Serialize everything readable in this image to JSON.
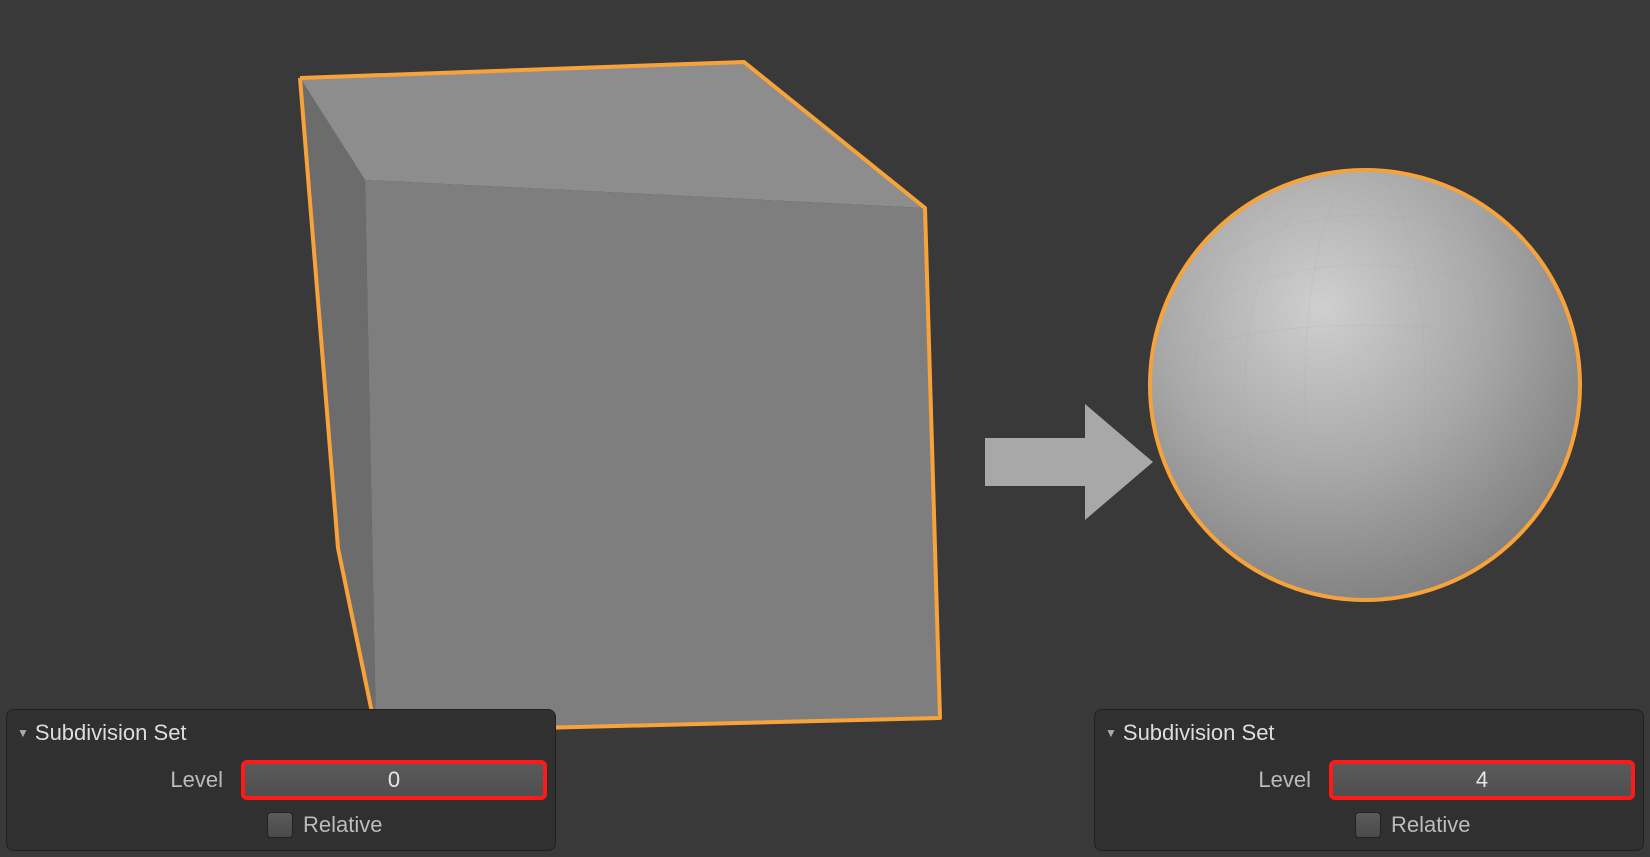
{
  "panels": {
    "left": {
      "title": "Subdivision Set",
      "level_label": "Level",
      "level_value": "0",
      "relative_label": "Relative",
      "relative_checked": false
    },
    "right": {
      "title": "Subdivision Set",
      "level_label": "Level",
      "level_value": "4",
      "relative_label": "Relative",
      "relative_checked": false
    }
  },
  "colors": {
    "selection_outline": "#f8a33a",
    "highlight": "#ff1a1a"
  }
}
